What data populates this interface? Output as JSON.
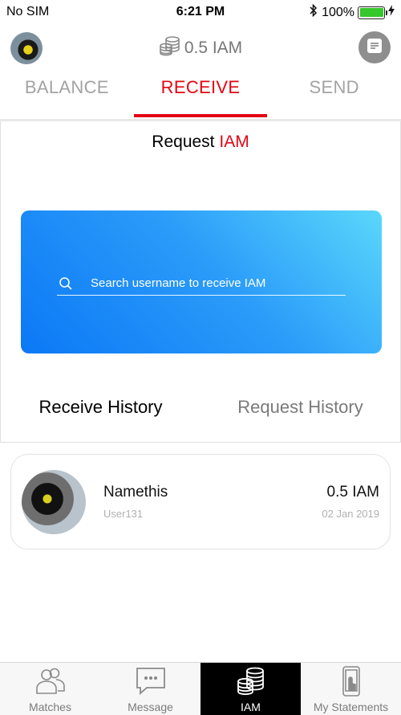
{
  "status_bar": {
    "carrier": "No SIM",
    "time": "6:21 PM",
    "battery": "100%"
  },
  "header": {
    "balance": "0.5 IAM"
  },
  "tabs": [
    {
      "label": "BALANCE",
      "active": false
    },
    {
      "label": "RECEIVE",
      "active": true
    },
    {
      "label": "SEND",
      "active": false
    }
  ],
  "request": {
    "title_prefix": "Request",
    "title_accent": "IAM",
    "search_placeholder": "Search username to receive IAM"
  },
  "history_tabs": [
    {
      "label": "Receive History",
      "active": true
    },
    {
      "label": "Request History",
      "active": false
    }
  ],
  "history": [
    {
      "name": "Namethis",
      "username": "User131",
      "amount": "0.5 IAM",
      "date": "02 Jan 2019"
    }
  ],
  "bottom_nav": [
    {
      "label": "Matches",
      "icon": "people-icon",
      "active": false
    },
    {
      "label": "Message",
      "icon": "chat-bubble-icon",
      "active": false
    },
    {
      "label": "IAM",
      "icon": "coins-icon",
      "active": true
    },
    {
      "label": "My Statements",
      "icon": "phone-touch-icon",
      "active": false
    }
  ],
  "colors": {
    "accent": "#e30613",
    "card_gradient_start": "#0b78f6",
    "card_gradient_end": "#5ad7fb",
    "battery": "#35c82a"
  }
}
